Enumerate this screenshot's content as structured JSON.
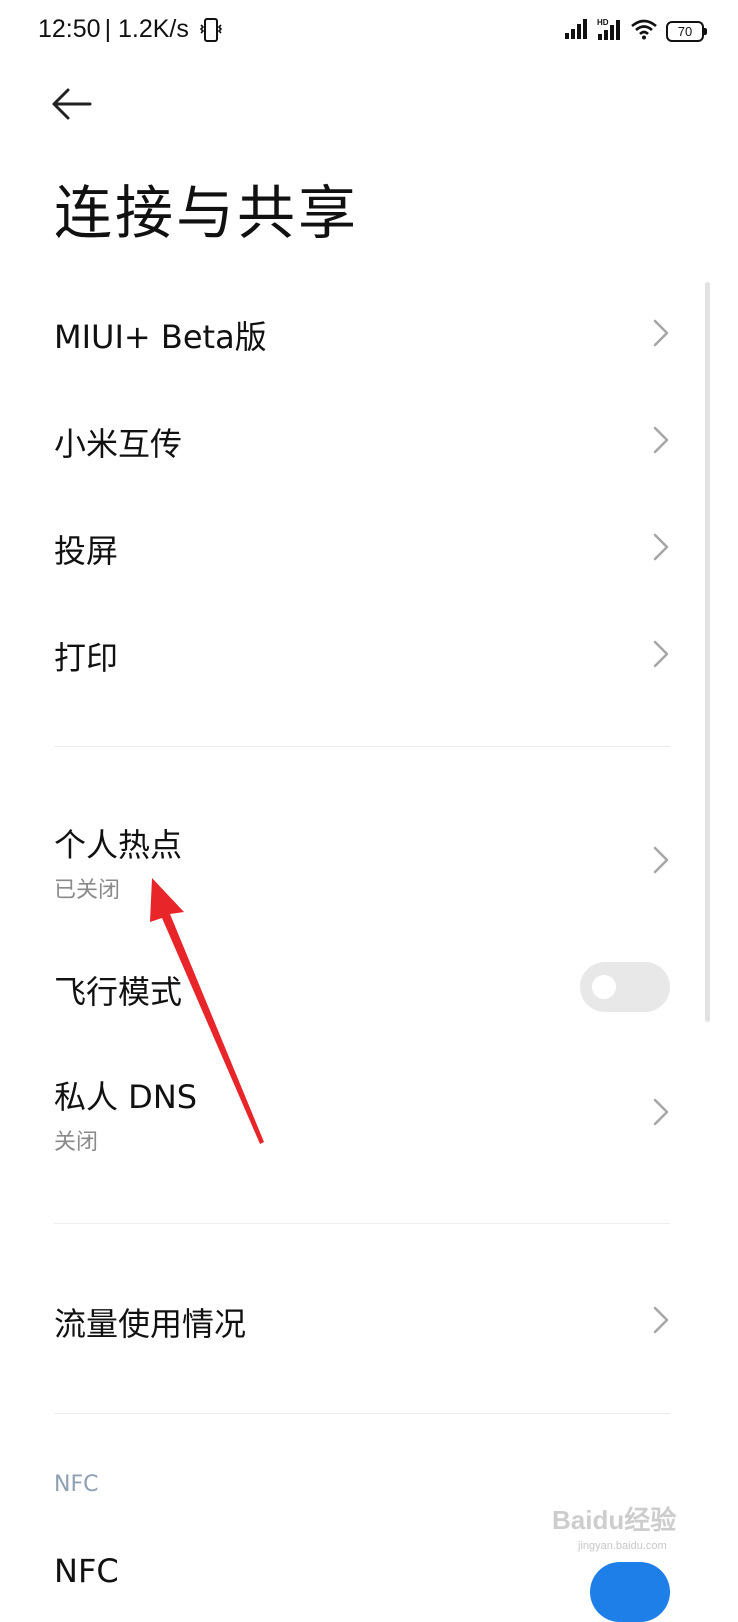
{
  "status_bar": {
    "time": "12:50",
    "speed": "| 1.2K/s",
    "battery": "70",
    "icons": [
      "vibrate-icon",
      "signal-icon",
      "hd-signal-icon",
      "wifi-icon",
      "battery-icon"
    ]
  },
  "header": {
    "back_icon": "back-arrow-icon",
    "title": "连接与共享"
  },
  "items": [
    {
      "label": "MIUI+ Beta版"
    },
    {
      "label": "小米互传"
    },
    {
      "label": "投屏"
    },
    {
      "label": "打印"
    },
    {
      "label": "个人热点",
      "sub": "已关闭"
    },
    {
      "label": "飞行模式",
      "toggle": false
    },
    {
      "label": "私人 DNS",
      "sub": "关闭"
    },
    {
      "label": "流量使用情况"
    }
  ],
  "nfc_section": {
    "header": "NFC",
    "item_label": "NFC",
    "toggle": true
  },
  "watermark": {
    "text": "Baidu经验",
    "sub": "jingyan.baidu.com"
  },
  "colors": {
    "annotation_arrow": "#e8262a",
    "accent": "#1e7fe8"
  }
}
